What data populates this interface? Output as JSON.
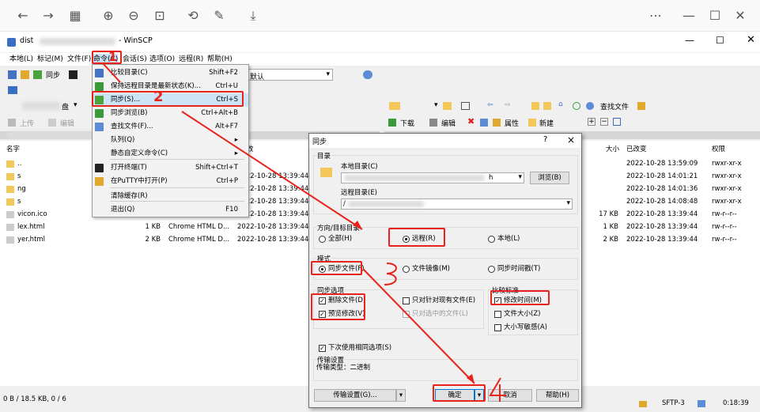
{
  "window_title": "dist",
  "window_title_suffix": "- WinSCP",
  "menubar": [
    "本地(L)",
    "标记(M)",
    "文件(F)",
    "命令(C)",
    "会话(S)",
    "选项(O)",
    "远程(R)",
    "帮助(H)"
  ],
  "toolbar": {
    "sync_label": "同步",
    "queue_label": "默认"
  },
  "local_panel": {
    "upload": "上传",
    "edit": "编辑",
    "col_name": "名字",
    "files": [
      {
        "name": "..",
        "size": "",
        "type": "",
        "changed": ""
      },
      {
        "name": "s",
        "size": "",
        "type": "",
        "changed": "2022-10-28  13:39:44"
      },
      {
        "name": "ng",
        "size": "",
        "type": "",
        "changed": "2022-10-28  13:39:44"
      },
      {
        "name": "s",
        "size": "",
        "type": "",
        "changed": "2022-10-28  13:39:44"
      },
      {
        "name": "vicon.ico",
        "size": "",
        "type": "",
        "changed": "2022-10-28  13:39:44"
      },
      {
        "name": "lex.html",
        "size": "1 KB",
        "type": "Chrome HTML D...",
        "changed": "2022-10-28  13:39:44"
      },
      {
        "name": "yer.html",
        "size": "2 KB",
        "type": "Chrome HTML D...",
        "changed": "2022-10-28  13:39:44"
      }
    ],
    "col_changed_fragment": "改"
  },
  "remote_panel": {
    "find_files": "查找文件",
    "download": "下载",
    "edit": "编辑",
    "properties": "属性",
    "new": "新建",
    "col_size": "大小",
    "col_changed": "已改变",
    "col_rights": "权限",
    "files": [
      {
        "size": "",
        "changed": "2022-10-28  13:59:09",
        "rights": "rwxr-xr-x"
      },
      {
        "size": "",
        "changed": "2022-10-28  14:01:21",
        "rights": "rwxr-xr-x"
      },
      {
        "size": "",
        "changed": "2022-10-28  14:01:36",
        "rights": "rwxr-xr-x"
      },
      {
        "size": "",
        "changed": "2022-10-28  14:08:48",
        "rights": "rwxr-xr-x"
      },
      {
        "size": "17 KB",
        "changed": "2022-10-28  13:39:44",
        "rights": "rw-r--r--"
      },
      {
        "size": "1 KB",
        "changed": "2022-10-28  13:39:44",
        "rights": "rw-r--r--"
      },
      {
        "size": "2 KB",
        "changed": "2022-10-28  13:39:44",
        "rights": "rw-r--r--"
      }
    ]
  },
  "command_menu": {
    "items": [
      {
        "label": "比较目录(C)",
        "shortcut": "Shift+F2"
      },
      {
        "label": "保持远程目录是最新状态(K)...",
        "shortcut": "Ctrl+U"
      },
      {
        "label": "同步(S)...",
        "shortcut": "Ctrl+S"
      },
      {
        "label": "同步浏览(B)",
        "shortcut": "Ctrl+Alt+B"
      },
      {
        "label": "查找文件(F)...",
        "shortcut": "Alt+F7"
      },
      {
        "label": "队列(Q)",
        "shortcut": "▸"
      },
      {
        "label": "静态自定义命令(C)",
        "shortcut": "▸"
      },
      {
        "label": "打开终端(T)",
        "shortcut": "Shift+Ctrl+T"
      },
      {
        "label": "在PuTTY中打开(P)",
        "shortcut": "Ctrl+P"
      },
      {
        "label": "清除缓存(R)",
        "shortcut": ""
      },
      {
        "label": "退出(Q)",
        "shortcut": "F10"
      }
    ]
  },
  "sync_dialog": {
    "title": "同步",
    "help": "?",
    "close": "×",
    "dirs_group": "目录",
    "local_dir_label": "本地目录(C)",
    "local_dir_value": "h",
    "browse": "浏览(B)",
    "remote_dir_label": "远程目录(E)",
    "remote_dir_value": "/",
    "direction_group": "方向/目标目录",
    "direction_options": [
      "全部(H)",
      "远程(R)",
      "本地(L)"
    ],
    "mode_group": "模式",
    "mode_options": [
      "同步文件(F)",
      "文件镜像(M)",
      "同步时间戳(T)"
    ],
    "sync_options_group": "同步选项",
    "opt_delete": "删除文件(D)",
    "opt_preview": "预览修改(V)",
    "opt_existing_only": "只对针对现有文件(E)",
    "opt_selected_only": "只对选中的文件(L)",
    "compare_group": "比较标准",
    "cmp_mtime": "修改时间(M)",
    "cmp_size": "文件大小(Z)",
    "cmp_case": "大小写敏感(A)",
    "remember": "下次使用相同选项(S)",
    "transfer_group": "传输设置",
    "transfer_type": "传输类型：二进制",
    "transfer_settings": "传输设置(G)...",
    "ok": "确定",
    "cancel": "取消",
    "help_btn": "帮助(H)"
  },
  "status_bar": {
    "left": "0 B / 18.5 KB,  0 / 6",
    "protocol": "SFTP-3",
    "time": "0:18:39"
  },
  "annotations": [
    "1",
    "2",
    "3",
    "4"
  ]
}
